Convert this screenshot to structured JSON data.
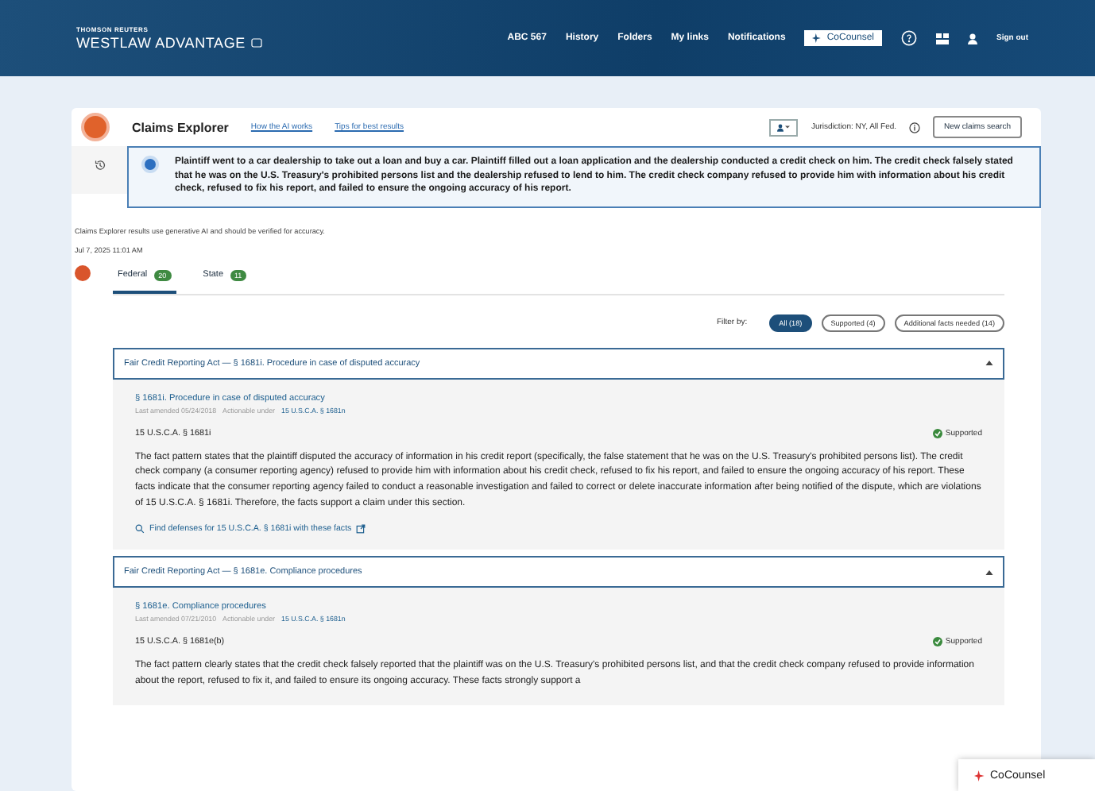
{
  "header": {
    "brand_small": "THOMSON REUTERS",
    "brand": "WESTLAW ADVANTAGE",
    "nav": [
      "ABC 567",
      "History",
      "Folders",
      "My links",
      "Notifications"
    ],
    "cocounsel": "CoCounsel",
    "sign_out": "Sign out"
  },
  "explorer": {
    "title": "Claims Explorer",
    "links": [
      "How the AI works",
      "Tips for best results"
    ],
    "jurisdiction": "Jurisdiction: NY, All Fed.",
    "new_search": "New claims search"
  },
  "query": "Plaintiff went to a car dealership to take out a loan and buy a car. Plaintiff filled out a loan application and the dealership conducted a credit check on him. The credit check falsely stated that he was on the U.S. Treasury's prohibited persons list and the dealership refused to lend to him. The credit check company refused to provide him with information about his credit check, refused to fix his report, and failed to ensure the ongoing accuracy of his report.",
  "disclaimer": "Claims Explorer results use generative AI and should be verified for accuracy.",
  "timestamp": "Jul 7, 2025 11:01 AM",
  "tabs": [
    {
      "label": "Federal",
      "count": "20",
      "selected": true
    },
    {
      "label": "State",
      "count": "11",
      "selected": false
    }
  ],
  "filter_label": "Filter by:",
  "filters": [
    {
      "label": "All (18)",
      "selected": true
    },
    {
      "label": "Supported (4)",
      "selected": false
    },
    {
      "label": "Additional facts needed (14)",
      "selected": false
    }
  ],
  "sections": [
    {
      "heading": "Fair Credit Reporting Act — § 1681i. Procedure in case of disputed accuracy",
      "expanded": true,
      "title": "§ 1681i. Procedure in case of disputed accuracy",
      "amended": "Last amended 05/24/2018",
      "actionable_label": "Actionable under",
      "actionable_link": "15 U.S.C.A. § 1681n",
      "citation": "15 U.S.C.A. § 1681i",
      "status": "Supported",
      "body": "The fact pattern states that the plaintiff disputed the accuracy of information in his credit report (specifically, the false statement that he was on the U.S. Treasury's prohibited persons list). The credit check company (a consumer reporting agency) refused to provide him with information about his credit check, refused to fix his report, and failed to ensure the ongoing accuracy of his report. These facts indicate that the consumer reporting agency failed to conduct a reasonable investigation and failed to correct or delete inaccurate information after being notified of the dispute, which are violations of 15 U.S.C.A. § 1681i. Therefore, the facts support a claim under this section.",
      "find_link": "Find defenses for 15 U.S.C.A. § 1681i with these facts"
    },
    {
      "heading": "Fair Credit Reporting Act — § 1681e. Compliance procedures",
      "expanded": true,
      "title": "§ 1681e. Compliance procedures",
      "amended": "Last amended 07/21/2010",
      "actionable_label": "Actionable under",
      "actionable_link": "15 U.S.C.A. § 1681n",
      "citation": "15 U.S.C.A. § 1681e(b)",
      "status": "Supported",
      "body": "The fact pattern clearly states that the credit check falsely reported that the plaintiff was on the U.S. Treasury's prohibited persons list, and that the credit check company refused to provide information about the report, refused to fix it, and failed to ensure its ongoing accuracy. These facts strongly support a"
    }
  ],
  "floating_button": "CoCounsel"
}
